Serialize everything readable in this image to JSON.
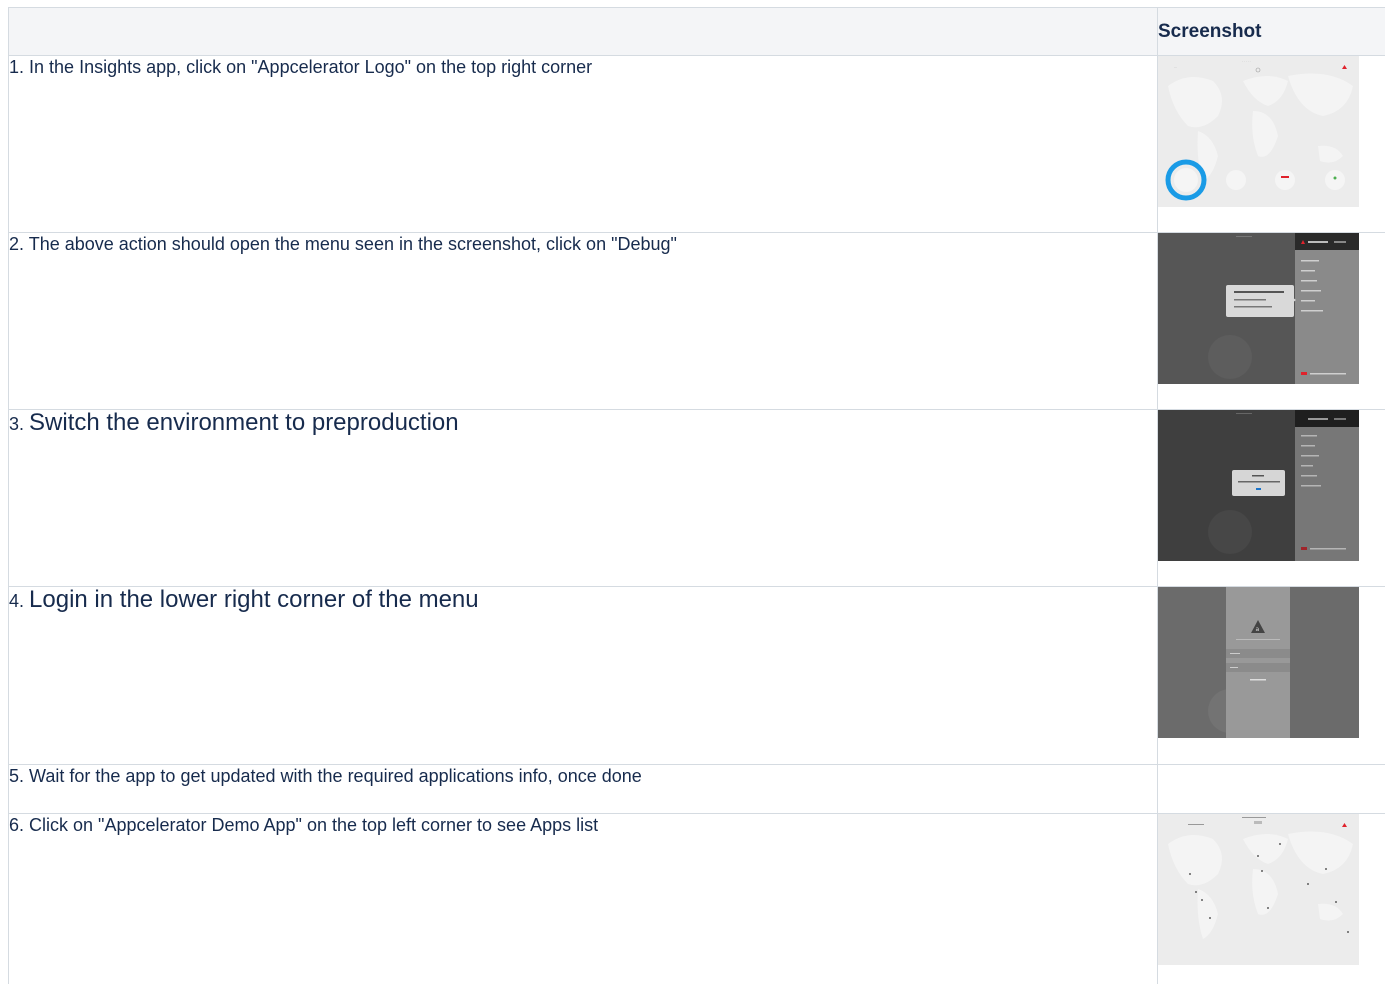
{
  "table": {
    "header": {
      "description": "",
      "screenshot": "Screenshot"
    },
    "rows": [
      {
        "num": "1.",
        "text": "In the Insights app, click on \"Appcelerator Logo\" on the top right corner",
        "style": "normal"
      },
      {
        "num": "2.",
        "text": "The above action should open the menu seen in the screenshot, click on \"Debug\"",
        "style": "normal"
      },
      {
        "num": "3.",
        "text": "Switch the environment to preproduction",
        "style": "big"
      },
      {
        "num": "4.",
        "text": "Login in the lower right corner of the menu",
        "style": "big"
      },
      {
        "num": "5.",
        "text": "Wait for the app to get updated with the required applications info, once done",
        "style": "normal"
      },
      {
        "num": "6.",
        "text": "Click on \"Appcelerator Demo App\" on the top left corner to see Apps list",
        "style": "normal"
      }
    ]
  },
  "colors": {
    "highlight_ring": "#1a9be6",
    "logo_red": "#e0222c",
    "header_bg": "#f4f5f7",
    "border": "#d5dbe1"
  }
}
